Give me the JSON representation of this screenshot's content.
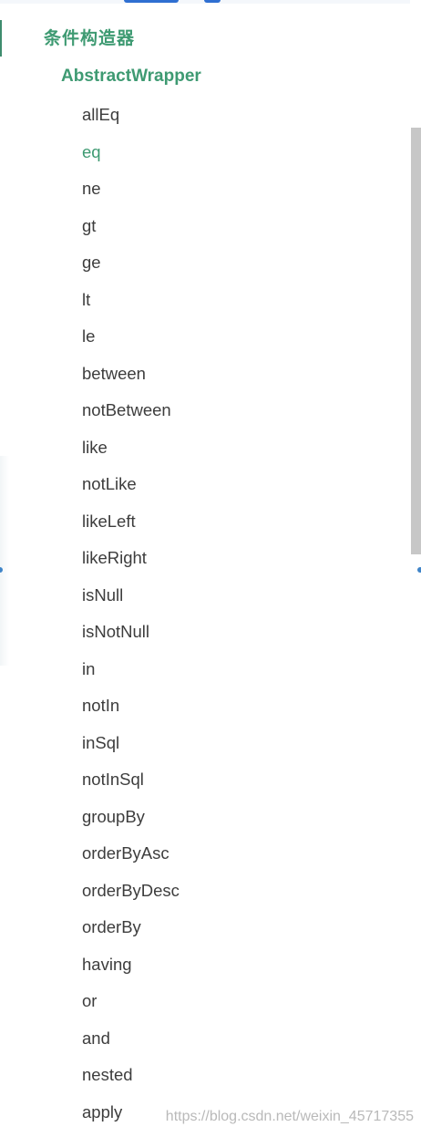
{
  "heading": "条件构造器",
  "subheading": "AbstractWrapper",
  "methods": [
    {
      "label": "allEq",
      "active": false
    },
    {
      "label": "eq",
      "active": true
    },
    {
      "label": "ne",
      "active": false
    },
    {
      "label": "gt",
      "active": false
    },
    {
      "label": "ge",
      "active": false
    },
    {
      "label": "lt",
      "active": false
    },
    {
      "label": "le",
      "active": false
    },
    {
      "label": "between",
      "active": false
    },
    {
      "label": "notBetween",
      "active": false
    },
    {
      "label": "like",
      "active": false
    },
    {
      "label": "notLike",
      "active": false
    },
    {
      "label": "likeLeft",
      "active": false
    },
    {
      "label": "likeRight",
      "active": false
    },
    {
      "label": "isNull",
      "active": false
    },
    {
      "label": "isNotNull",
      "active": false
    },
    {
      "label": "in",
      "active": false
    },
    {
      "label": "notIn",
      "active": false
    },
    {
      "label": "inSql",
      "active": false
    },
    {
      "label": "notInSql",
      "active": false
    },
    {
      "label": "groupBy",
      "active": false
    },
    {
      "label": "orderByAsc",
      "active": false
    },
    {
      "label": "orderByDesc",
      "active": false
    },
    {
      "label": "orderBy",
      "active": false
    },
    {
      "label": "having",
      "active": false
    },
    {
      "label": "or",
      "active": false
    },
    {
      "label": "and",
      "active": false
    },
    {
      "label": "nested",
      "active": false
    },
    {
      "label": "apply",
      "active": false
    }
  ],
  "watermark": "https://blog.csdn.net/weixin_45717355",
  "colors": {
    "accent": "#3e9a72",
    "text": "#3d3d3d",
    "scroll_thumb": "#c7c7c7",
    "top_bar": "#2f6fd1"
  }
}
